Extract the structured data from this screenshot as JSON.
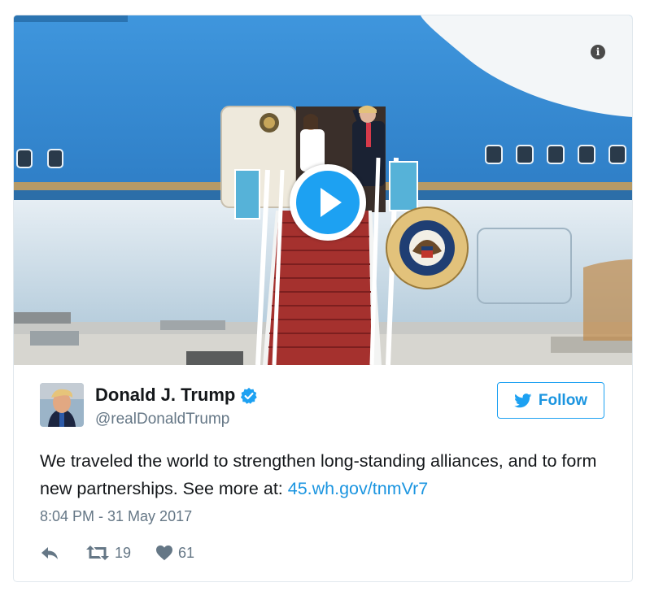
{
  "tweet": {
    "author_name": "Donald J. Trump",
    "handle": "@realDonaldTrump",
    "follow_label": "Follow",
    "text_main": "We traveled the world to strengthen long-standing alliances, and to form new partnerships. See more at: ",
    "link_text": "45.wh.gov/tnmVr7",
    "timestamp": "8:04 PM - 31 May 2017",
    "retweet_count": "19",
    "like_count": "61",
    "verified": true
  },
  "media": {
    "type": "video",
    "info_glyph": "i",
    "seal_text": "SEAL OF THE PRESIDENT OF THE UNITED STATES"
  },
  "icons": [
    "info-icon",
    "play-icon",
    "verified-badge-icon",
    "twitter-bird-icon",
    "reply-icon",
    "retweet-icon",
    "like-icon"
  ],
  "colors": {
    "accent": "#1da1f2",
    "link": "#1b95e0",
    "muted": "#657786",
    "border": "#e1e8ed",
    "plane_blue": "#3d8fd6",
    "carpet": "#a5312e"
  }
}
